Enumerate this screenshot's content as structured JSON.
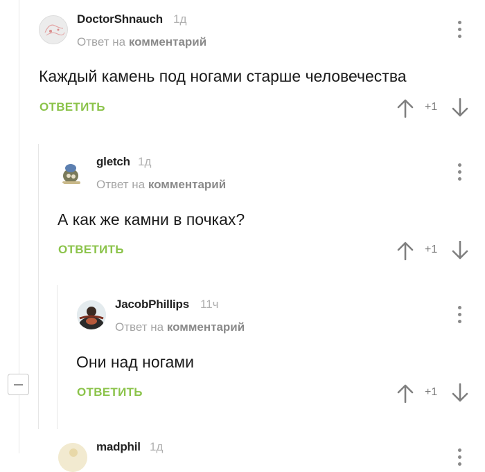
{
  "comments": [
    {
      "username": "DoctorShnauch",
      "time": "1д",
      "reply_prefix": "Ответ на",
      "reply_link": "комментарий",
      "text": "Каждый камень под ногами старше человечества",
      "reply_label": "ОТВЕТИТЬ",
      "rating": "+1",
      "avatar": "avatar-doctorshnauch"
    },
    {
      "username": "gletch",
      "time": "1д",
      "reply_prefix": "Ответ на",
      "reply_link": "комментарий",
      "text": "А как же камни в почках?",
      "reply_label": "ОТВЕТИТЬ",
      "rating": "+1",
      "avatar": "avatar-gletch"
    },
    {
      "username": "JacobPhillips",
      "time": "11ч",
      "reply_prefix": "Ответ на",
      "reply_link": "комментарий",
      "text": "Они над ногами",
      "reply_label": "ОТВЕТИТЬ",
      "rating": "+1",
      "avatar": "avatar-jacobphillips"
    },
    {
      "username": "madphil",
      "time": "1д",
      "avatar": "avatar-madphil"
    }
  ],
  "colors": {
    "accent_green": "#8bc34a",
    "meta_gray": "#a5a5a5",
    "thread_line": "#e6e6e6"
  },
  "icons": [
    "more-vertical-icon",
    "arrow-up-icon",
    "arrow-down-icon",
    "collapse-minus-icon"
  ]
}
